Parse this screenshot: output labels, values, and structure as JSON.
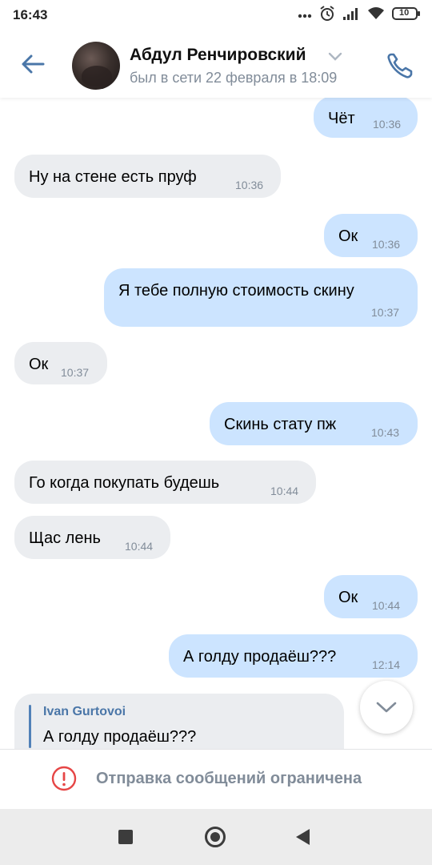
{
  "status_bar": {
    "time": "16:43",
    "battery": "10"
  },
  "header": {
    "contact_name": "Абдул Ренчировский",
    "contact_status": "был в сети 22 февраля в 18:09"
  },
  "messages": [
    {
      "direction": "out",
      "text": "Чёт",
      "time": "10:36"
    },
    {
      "direction": "in",
      "text": "Ну на стене есть пруф",
      "time": "10:36"
    },
    {
      "direction": "out",
      "text": "Ок",
      "time": "10:36"
    },
    {
      "direction": "out",
      "text": "Я тебе полную стоимость скину",
      "time": "10:37"
    },
    {
      "direction": "in",
      "text": "Ок",
      "time": "10:37"
    },
    {
      "direction": "out",
      "text": "Скинь стату пж",
      "time": "10:43"
    },
    {
      "direction": "in",
      "text": "Го когда покупать будешь",
      "time": "10:44"
    },
    {
      "direction": "in",
      "text": "Щас лень",
      "time": "10:44"
    },
    {
      "direction": "out",
      "text": "Ок",
      "time": "10:44"
    },
    {
      "direction": "out",
      "text": "А голду продаёш???",
      "time": "12:14"
    }
  ],
  "reply_message": {
    "direction": "in",
    "quoted_author": "Ivan Gurtovoi",
    "quoted_text": "А голду продаёш???"
  },
  "restricted_notice": "Отправка сообщений ограничена",
  "colors": {
    "accent": "#4a76a8",
    "outgoing_bubble": "#cce4ff",
    "incoming_bubble": "#ebedf0",
    "warning": "#e64646"
  },
  "icons": [
    "back-arrow-icon",
    "chevron-down-icon",
    "phone-icon",
    "scroll-down-icon",
    "warning-icon",
    "nav-recents-icon",
    "nav-home-icon",
    "nav-back-icon"
  ]
}
